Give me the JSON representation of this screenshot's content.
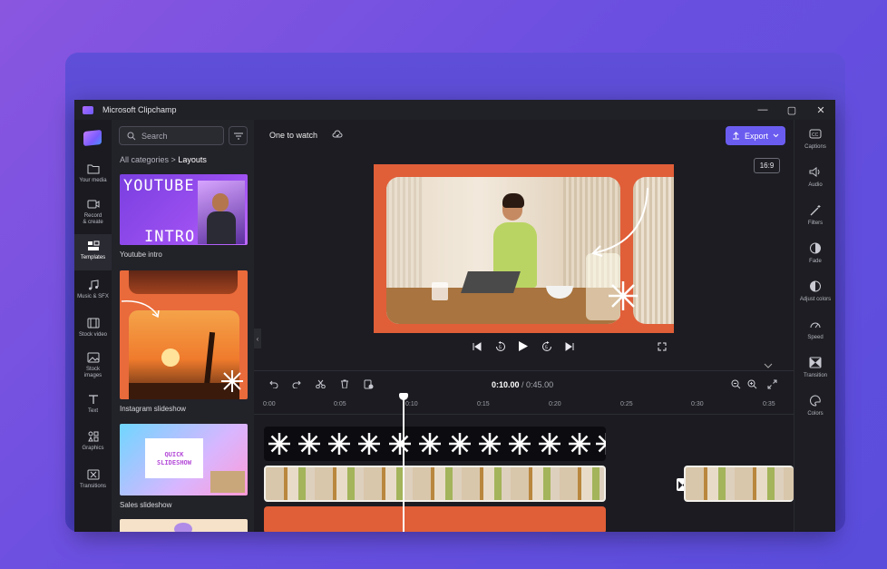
{
  "window": {
    "title": "Microsoft Clipchamp",
    "minimize": "—",
    "maximize": "▢",
    "close": "✕"
  },
  "leftnav": [
    {
      "label": "Your media",
      "icon": "folder-icon"
    },
    {
      "label": "Record & create",
      "icon": "camera-icon"
    },
    {
      "label": "Templates",
      "icon": "templates-icon",
      "active": true
    },
    {
      "label": "Music & SFX",
      "icon": "music-icon"
    },
    {
      "label": "Stock video",
      "icon": "film-icon"
    },
    {
      "label": "Stock images",
      "icon": "image-icon"
    },
    {
      "label": "Text",
      "icon": "text-icon"
    },
    {
      "label": "Graphics",
      "icon": "graphics-icon"
    },
    {
      "label": "Transitions",
      "icon": "transitions-icon"
    }
  ],
  "panel": {
    "search_placeholder": "Search",
    "breadcrumb_root": "All categories",
    "breadcrumb_sep": ">",
    "breadcrumb_current": "Layouts",
    "templates": [
      {
        "label": "Youtube intro",
        "line1": "YOUTUBE",
        "line2": "INTRO"
      },
      {
        "label": "Instagram slideshow"
      },
      {
        "label": "Sales slideshow",
        "line1": "QUICK",
        "line2": "SLIDESHOW"
      }
    ]
  },
  "topbar": {
    "project_title": "One to watch",
    "export_label": "Export",
    "aspect_ratio": "16:9"
  },
  "rightbar": [
    {
      "label": "Captions",
      "icon": "captions-icon"
    },
    {
      "label": "Audio",
      "icon": "speaker-icon"
    },
    {
      "label": "Filters",
      "icon": "wand-icon"
    },
    {
      "label": "Fade",
      "icon": "fade-icon"
    },
    {
      "label": "Adjust colors",
      "icon": "contrast-icon"
    },
    {
      "label": "Speed",
      "icon": "speedometer-icon"
    },
    {
      "label": "Transition",
      "icon": "transition-icon"
    },
    {
      "label": "Colors",
      "icon": "palette-icon"
    }
  ],
  "timeline": {
    "current_time": "0:10.00",
    "separator": " / ",
    "total_time": "0:45.00",
    "ticks": [
      "0:00",
      "0:05",
      "0:10",
      "0:15",
      "0:20",
      "0:25",
      "0:30",
      "0:35"
    ]
  },
  "colors": {
    "accent": "#6b5cf0",
    "preview_bg": "#e05e38",
    "background": "#7a52e0"
  }
}
